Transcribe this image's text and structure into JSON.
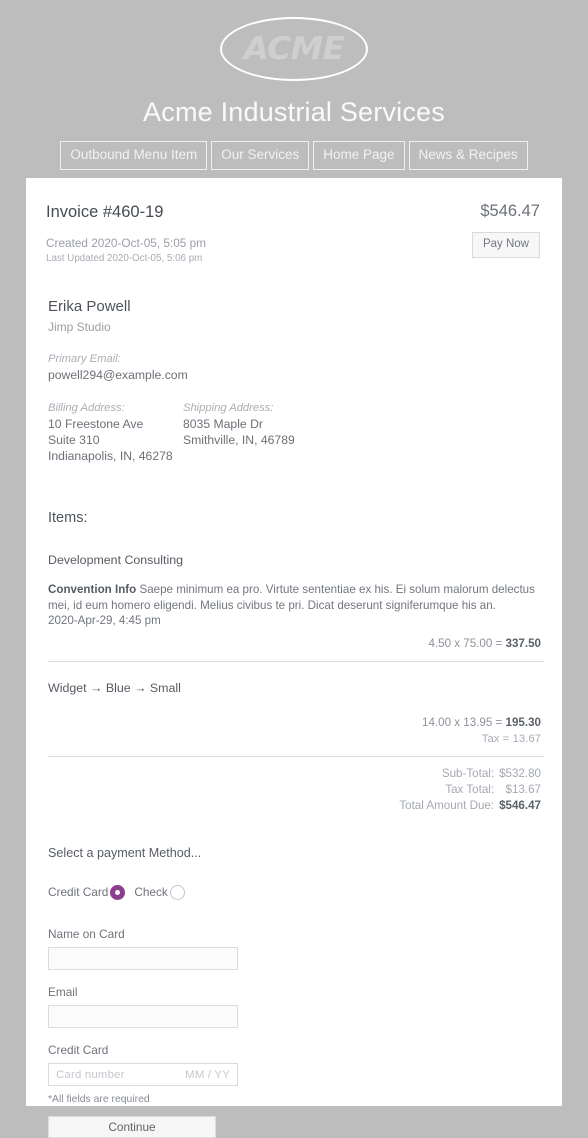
{
  "site": {
    "logo_text": "ACME",
    "title": "Acme Industrial Services",
    "nav": [
      {
        "label": "Outbound Menu Item"
      },
      {
        "label": "Our Services"
      },
      {
        "label": "Home Page"
      },
      {
        "label": "News & Recipes"
      }
    ]
  },
  "invoice": {
    "title": "Invoice #460-19",
    "amount": "$546.47",
    "pay_now_label": "Pay Now",
    "created": "Created 2020-Oct-05, 5:05 pm",
    "last_updated": "Last Updated 2020-Oct-05, 5:06 pm"
  },
  "customer": {
    "name": "Erika Powell",
    "org": "Jimp Studio",
    "email_label": "Primary Email:",
    "email": "powell294@example.com",
    "billing_label": "Billing Address:",
    "billing": [
      "10 Freestone Ave",
      "Suite 310",
      "Indianapolis, IN, 46278"
    ],
    "shipping_label": "Shipping Address:",
    "shipping": [
      "8035 Maple Dr",
      "Smithville, IN, 46789"
    ]
  },
  "items": {
    "heading": "Items:",
    "item1": {
      "name": "Development Consulting",
      "desc_bold": "Convention Info",
      "desc": " Saepe minimum ea pro. Virtute sententiae ex his. Ei solum malorum delectus mei, id eum homero eligendi. Melius civibus te pri. Dicat deserunt signiferumque his an.",
      "date": "2020-Apr-29, 4:45 pm",
      "calc_prefix": "4.50 x 75.00 = ",
      "calc_amount": "337.50"
    },
    "item2": {
      "name": "Widget → Blue → Small",
      "calc_prefix": "14.00 x 13.95 = ",
      "calc_amount": "195.30",
      "tax": "Tax = 13.67"
    }
  },
  "totals": [
    {
      "label": "Sub-Total:",
      "value": "$532.80"
    },
    {
      "label": "Tax Total:",
      "value": "$13.67"
    },
    {
      "label": "Total Amount Due:",
      "value": "$546.47"
    }
  ],
  "payment": {
    "heading": "Select a payment Method...",
    "credit_card_label": "Credit Card",
    "check_label": "Check",
    "selected": "Credit Card",
    "accent_color": "#8e3d8e",
    "name_label": "Name on Card",
    "name_value": "",
    "email_label": "Email",
    "email_value": "",
    "cc_label": "Credit Card",
    "cc_placeholder": "Card number",
    "cc_expiry_placeholder": "MM / YY",
    "required_note": "*All fields are required",
    "continue_label": "Continue"
  }
}
